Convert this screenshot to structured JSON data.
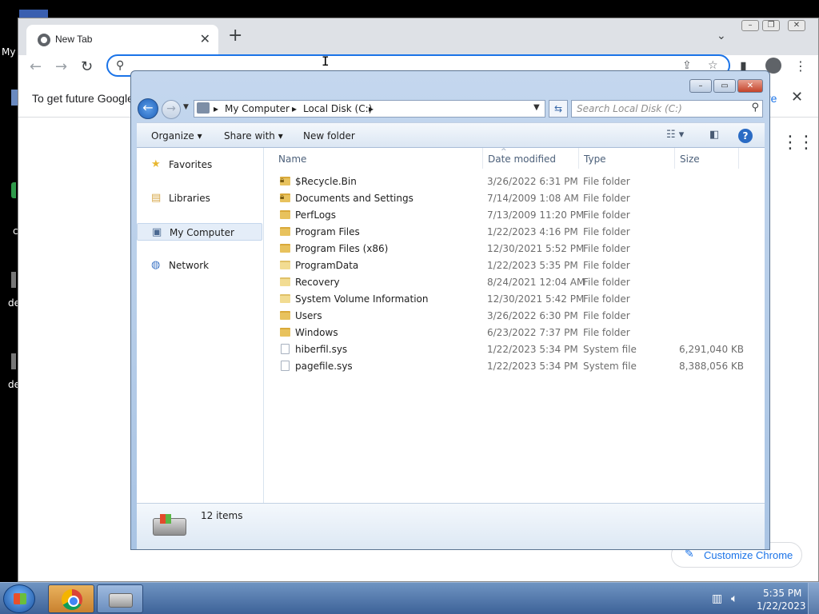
{
  "desktop": {
    "labels": [
      "My",
      "c",
      "de",
      "de"
    ]
  },
  "chrome": {
    "tab_title": "New Tab",
    "info_text": "To get future Google",
    "info_link": "re",
    "customize_label": "Customize Chrome"
  },
  "explorer": {
    "breadcrumbs": [
      "My Computer",
      "Local Disk (C:)"
    ],
    "search_placeholder": "Search Local Disk (C:)",
    "commands": {
      "organize": "Organize",
      "share_with": "Share with",
      "new_folder": "New folder"
    },
    "nav": [
      {
        "label": "Favorites",
        "icon": "star-icon"
      },
      {
        "label": "Libraries",
        "icon": "libraries-icon"
      },
      {
        "label": "My Computer",
        "icon": "computer-icon",
        "selected": true
      },
      {
        "label": "Network",
        "icon": "network-icon"
      }
    ],
    "columns": {
      "name": "Name",
      "date": "Date modified",
      "type": "Type",
      "size": "Size"
    },
    "files": [
      {
        "name": "$Recycle.Bin",
        "date": "3/26/2022 6:31 PM",
        "type": "File folder",
        "size": "",
        "kind": "locked"
      },
      {
        "name": "Documents and Settings",
        "date": "7/14/2009 1:08 AM",
        "type": "File folder",
        "size": "",
        "kind": "locked"
      },
      {
        "name": "PerfLogs",
        "date": "7/13/2009 11:20 PM",
        "type": "File folder",
        "size": "",
        "kind": "folder"
      },
      {
        "name": "Program Files",
        "date": "1/22/2023 4:16 PM",
        "type": "File folder",
        "size": "",
        "kind": "folder"
      },
      {
        "name": "Program Files (x86)",
        "date": "12/30/2021 5:52 PM",
        "type": "File folder",
        "size": "",
        "kind": "folder"
      },
      {
        "name": "ProgramData",
        "date": "1/22/2023 5:35 PM",
        "type": "File folder",
        "size": "",
        "kind": "light"
      },
      {
        "name": "Recovery",
        "date": "8/24/2021 12:04 AM",
        "type": "File folder",
        "size": "",
        "kind": "light"
      },
      {
        "name": "System Volume Information",
        "date": "12/30/2021 5:42 PM",
        "type": "File folder",
        "size": "",
        "kind": "light"
      },
      {
        "name": "Users",
        "date": "3/26/2022 6:30 PM",
        "type": "File folder",
        "size": "",
        "kind": "folder"
      },
      {
        "name": "Windows",
        "date": "6/23/2022 7:37 PM",
        "type": "File folder",
        "size": "",
        "kind": "folder"
      },
      {
        "name": "hiberfil.sys",
        "date": "1/22/2023 5:34 PM",
        "type": "System file",
        "size": "6,291,040 KB",
        "kind": "sys"
      },
      {
        "name": "pagefile.sys",
        "date": "1/22/2023 5:34 PM",
        "type": "System file",
        "size": "8,388,056 KB",
        "kind": "sys"
      }
    ],
    "item_count": "12 items"
  },
  "taskbar": {
    "time": "5:35 PM",
    "date": "1/22/2023"
  },
  "colors": {
    "chrome_accent": "#1a73e8",
    "explorer_frame": "#c4d7ee",
    "taskbar": "#3d6298"
  }
}
